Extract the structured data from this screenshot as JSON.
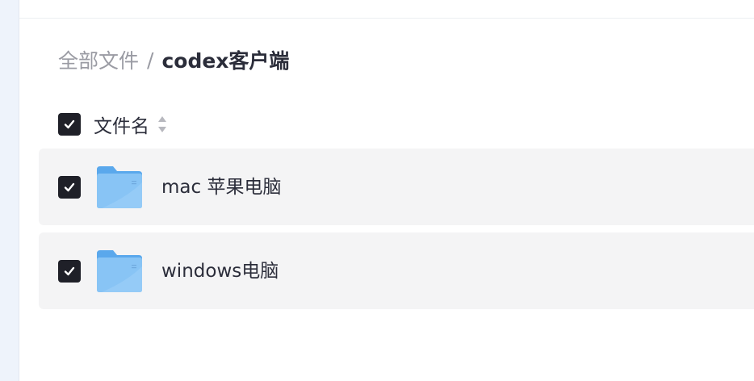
{
  "breadcrumb": {
    "root": "全部文件",
    "separator": "/",
    "current": "codex客户端"
  },
  "table": {
    "header_label": "文件名",
    "select_all_checked": true,
    "rows": [
      {
        "name": "mac 苹果电脑",
        "type_icon": "folder-icon",
        "checked": true
      },
      {
        "name": "windows电脑",
        "type_icon": "folder-icon",
        "checked": true
      }
    ]
  },
  "colors": {
    "checkbox": "#1f2028",
    "row_background": "#f4f4f5",
    "folder_blue": "#7fbcf2",
    "muted_text": "#9a9ba3",
    "primary_text": "#2b2d3a"
  }
}
